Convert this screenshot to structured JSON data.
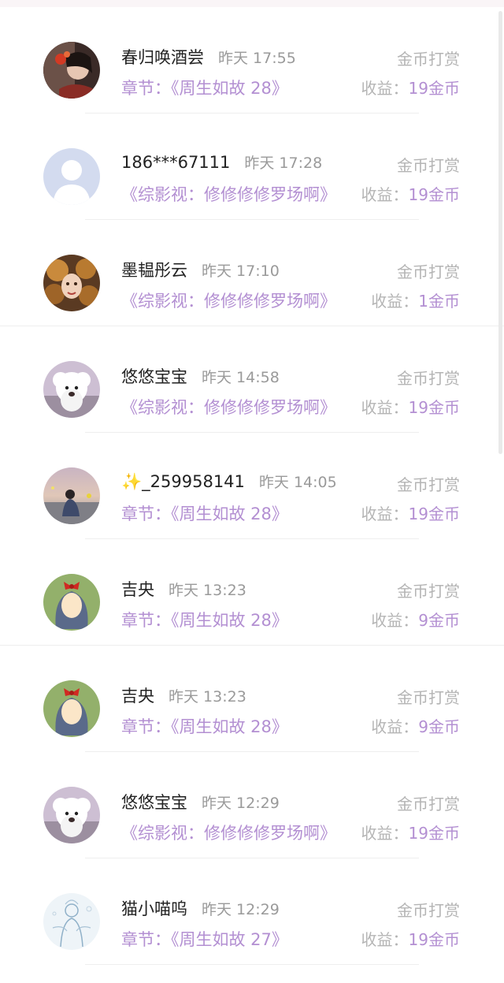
{
  "records": [
    {
      "name": "春归唤酒尝",
      "time": "昨天 17:55",
      "chapter": "章节：《周生如故 28》",
      "type": "金币打赏",
      "income_label": "收益：",
      "income_value": "19金币",
      "avatar": "art-red-hair"
    },
    {
      "name": "186***67111",
      "time": "昨天 17:28",
      "chapter": "《综影视：修修修修罗场啊》",
      "type": "金币打赏",
      "income_label": "收益：",
      "income_value": "19金币",
      "avatar": "default-user"
    },
    {
      "name": "墨韫彤云",
      "time": "昨天 17:10",
      "chapter": "《综影视：修修修修罗场啊》",
      "type": "金币打赏",
      "income_label": "收益：",
      "income_value": "1金币",
      "avatar": "art-curly-hair"
    },
    {
      "name": "悠悠宝宝",
      "time": "昨天 14:58",
      "chapter": "《综影视：修修修修罗场啊》",
      "type": "金币打赏",
      "income_label": "收益：",
      "income_value": "19金币",
      "avatar": "white-dog"
    },
    {
      "name": "✨_259958141",
      "time": "昨天 14:05",
      "chapter": "章节：《周生如故 28》",
      "type": "金币打赏",
      "income_label": "收益：",
      "income_value": "19金币",
      "avatar": "person-sitting"
    },
    {
      "name": "吉央",
      "time": "昨天 13:23",
      "chapter": "章节：《周生如故 28》",
      "type": "金币打赏",
      "income_label": "收益：",
      "income_value": "9金币",
      "avatar": "cartoon-girl-bow"
    },
    {
      "name": "吉央",
      "time": "昨天 13:23",
      "chapter": "章节：《周生如故 28》",
      "type": "金币打赏",
      "income_label": "收益：",
      "income_value": "9金币",
      "avatar": "cartoon-girl-bow"
    },
    {
      "name": "悠悠宝宝",
      "time": "昨天 12:29",
      "chapter": "《综影视：修修修修罗场啊》",
      "type": "金币打赏",
      "income_label": "收益：",
      "income_value": "19金币",
      "avatar": "white-dog"
    },
    {
      "name": "猫小喵呜",
      "time": "昨天 12:29",
      "chapter": "章节：《周生如故 27》",
      "type": "金币打赏",
      "income_label": "收益：",
      "income_value": "19金币",
      "avatar": "sketch-figure"
    }
  ],
  "colors": {
    "accent": "#b38fd2",
    "muted": "#b4b4b4",
    "time": "#9a9a9a",
    "name": "#222222"
  }
}
